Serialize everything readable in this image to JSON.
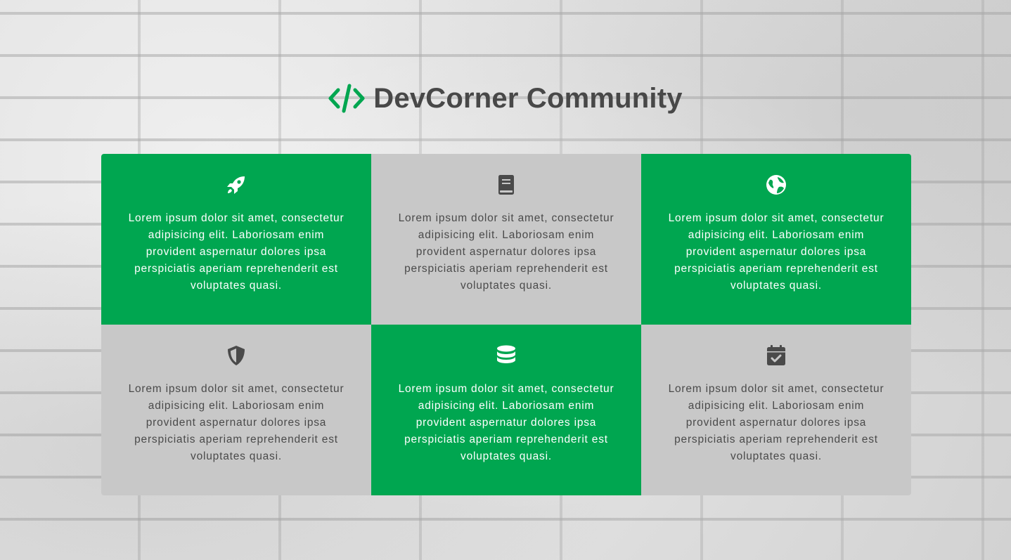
{
  "header": {
    "title": "DevCorner Community",
    "logo_icon": "code-icon"
  },
  "colors": {
    "green": "#00a650",
    "gray": "#c8c8c8",
    "title": "#484848"
  },
  "cards": [
    {
      "icon": "rocket-icon",
      "style": "green",
      "text": "Lorem ipsum dolor sit amet, consectetur adipisicing elit. Laboriosam enim provident aspernatur dolores ipsa perspiciatis aperiam reprehenderit est voluptates quasi."
    },
    {
      "icon": "book-icon",
      "style": "gray",
      "text": "Lorem ipsum dolor sit amet, consectetur adipisicing elit. Laboriosam enim provident aspernatur dolores ipsa perspiciatis aperiam reprehenderit est voluptates quasi."
    },
    {
      "icon": "globe-icon",
      "style": "green",
      "text": "Lorem ipsum dolor sit amet, consectetur adipisicing elit. Laboriosam enim provident aspernatur dolores ipsa perspiciatis aperiam reprehenderit est voluptates quasi."
    },
    {
      "icon": "shield-icon",
      "style": "gray",
      "text": "Lorem ipsum dolor sit amet, consectetur adipisicing elit. Laboriosam enim provident aspernatur dolores ipsa perspiciatis aperiam reprehenderit est voluptates quasi."
    },
    {
      "icon": "database-icon",
      "style": "green",
      "text": "Lorem ipsum dolor sit amet, consectetur adipisicing elit. Laboriosam enim provident aspernatur dolores ipsa perspiciatis aperiam reprehenderit est voluptates quasi."
    },
    {
      "icon": "calendar-check-icon",
      "style": "gray",
      "text": "Lorem ipsum dolor sit amet, consectetur adipisicing elit. Laboriosam enim provident aspernatur dolores ipsa perspiciatis aperiam reprehenderit est voluptates quasi."
    }
  ]
}
